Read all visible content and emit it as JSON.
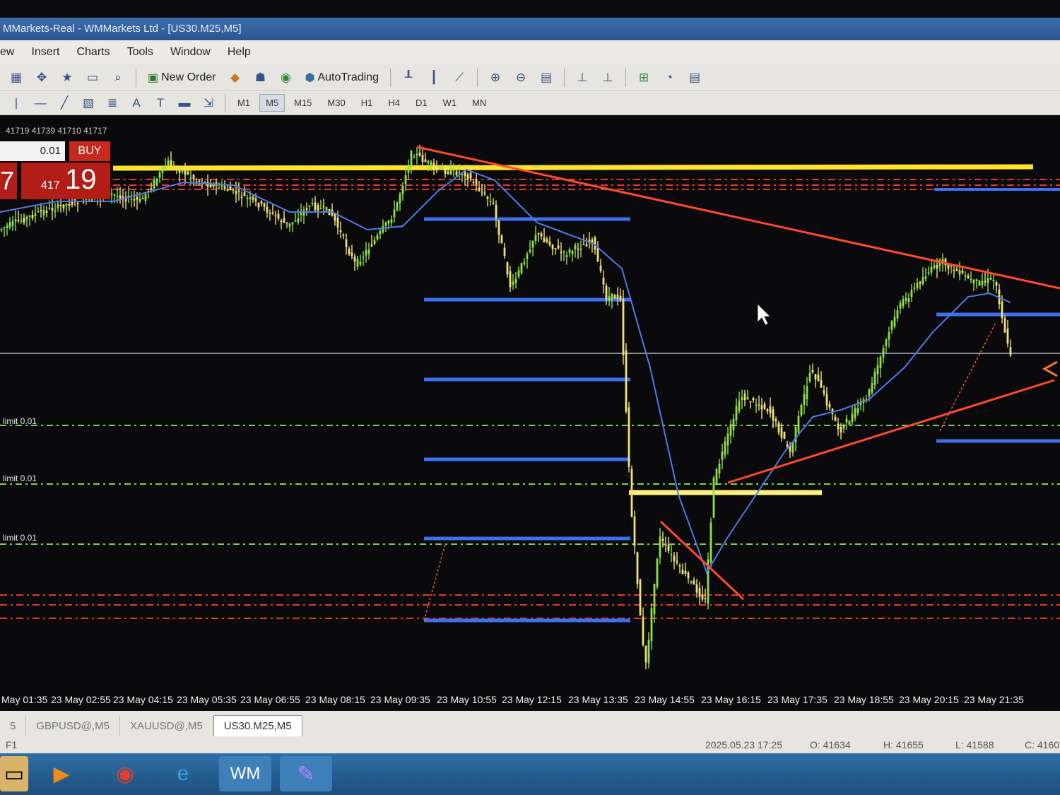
{
  "window": {
    "title": "MMarkets-Real - WMMarkets Ltd - [US30.M25,M5]"
  },
  "menu": [
    "ew",
    "Insert",
    "Charts",
    "Tools",
    "Window",
    "Help"
  ],
  "toolbar": {
    "new_order": "New Order",
    "autotrading": "AutoTrading"
  },
  "timeframes": [
    "M1",
    "M5",
    "M15",
    "M30",
    "H1",
    "H4",
    "D1",
    "W1",
    "MN"
  ],
  "active_timeframe": "M5",
  "ohlc_text": "41719 41739 41710 41717",
  "trade_panel": {
    "lot": "0.01",
    "buy_label": "BUY",
    "price_small": "417",
    "price_large": "19",
    "left_digit": "7"
  },
  "limits": [
    "limit 0.01",
    "limit 0.01",
    "limit 0.01"
  ],
  "x_axis": [
    "May 01:35",
    "23 May 02:55",
    "23 May 04:15",
    "23 May 05:35",
    "23 May 06:55",
    "23 May 08:15",
    "23 May 09:35",
    "23 May 10:55",
    "23 May 12:15",
    "23 May 13:35",
    "23 May 14:55",
    "23 May 16:15",
    "23 May 17:35",
    "23 May 18:55",
    "23 May 20:15",
    "23 May 21:35"
  ],
  "tabs": [
    "5",
    "GBPUSD@,M5",
    "XAUUSD@,M5",
    "US30.M25,M5"
  ],
  "active_tab": "US30.M25,M5",
  "status": {
    "help": "F1",
    "time": "2025.05.23 17:25",
    "open": "O: 41634",
    "high": "H: 41655",
    "low": "L: 41588",
    "close": "C: 4160"
  },
  "colors": {
    "bull": "#8ee04a",
    "bear": "#f0e07a",
    "ma": "#4f7be8",
    "trend": "#ff4a2a",
    "resistance": "#ffe32a",
    "fib": "#3d6ff0"
  }
}
